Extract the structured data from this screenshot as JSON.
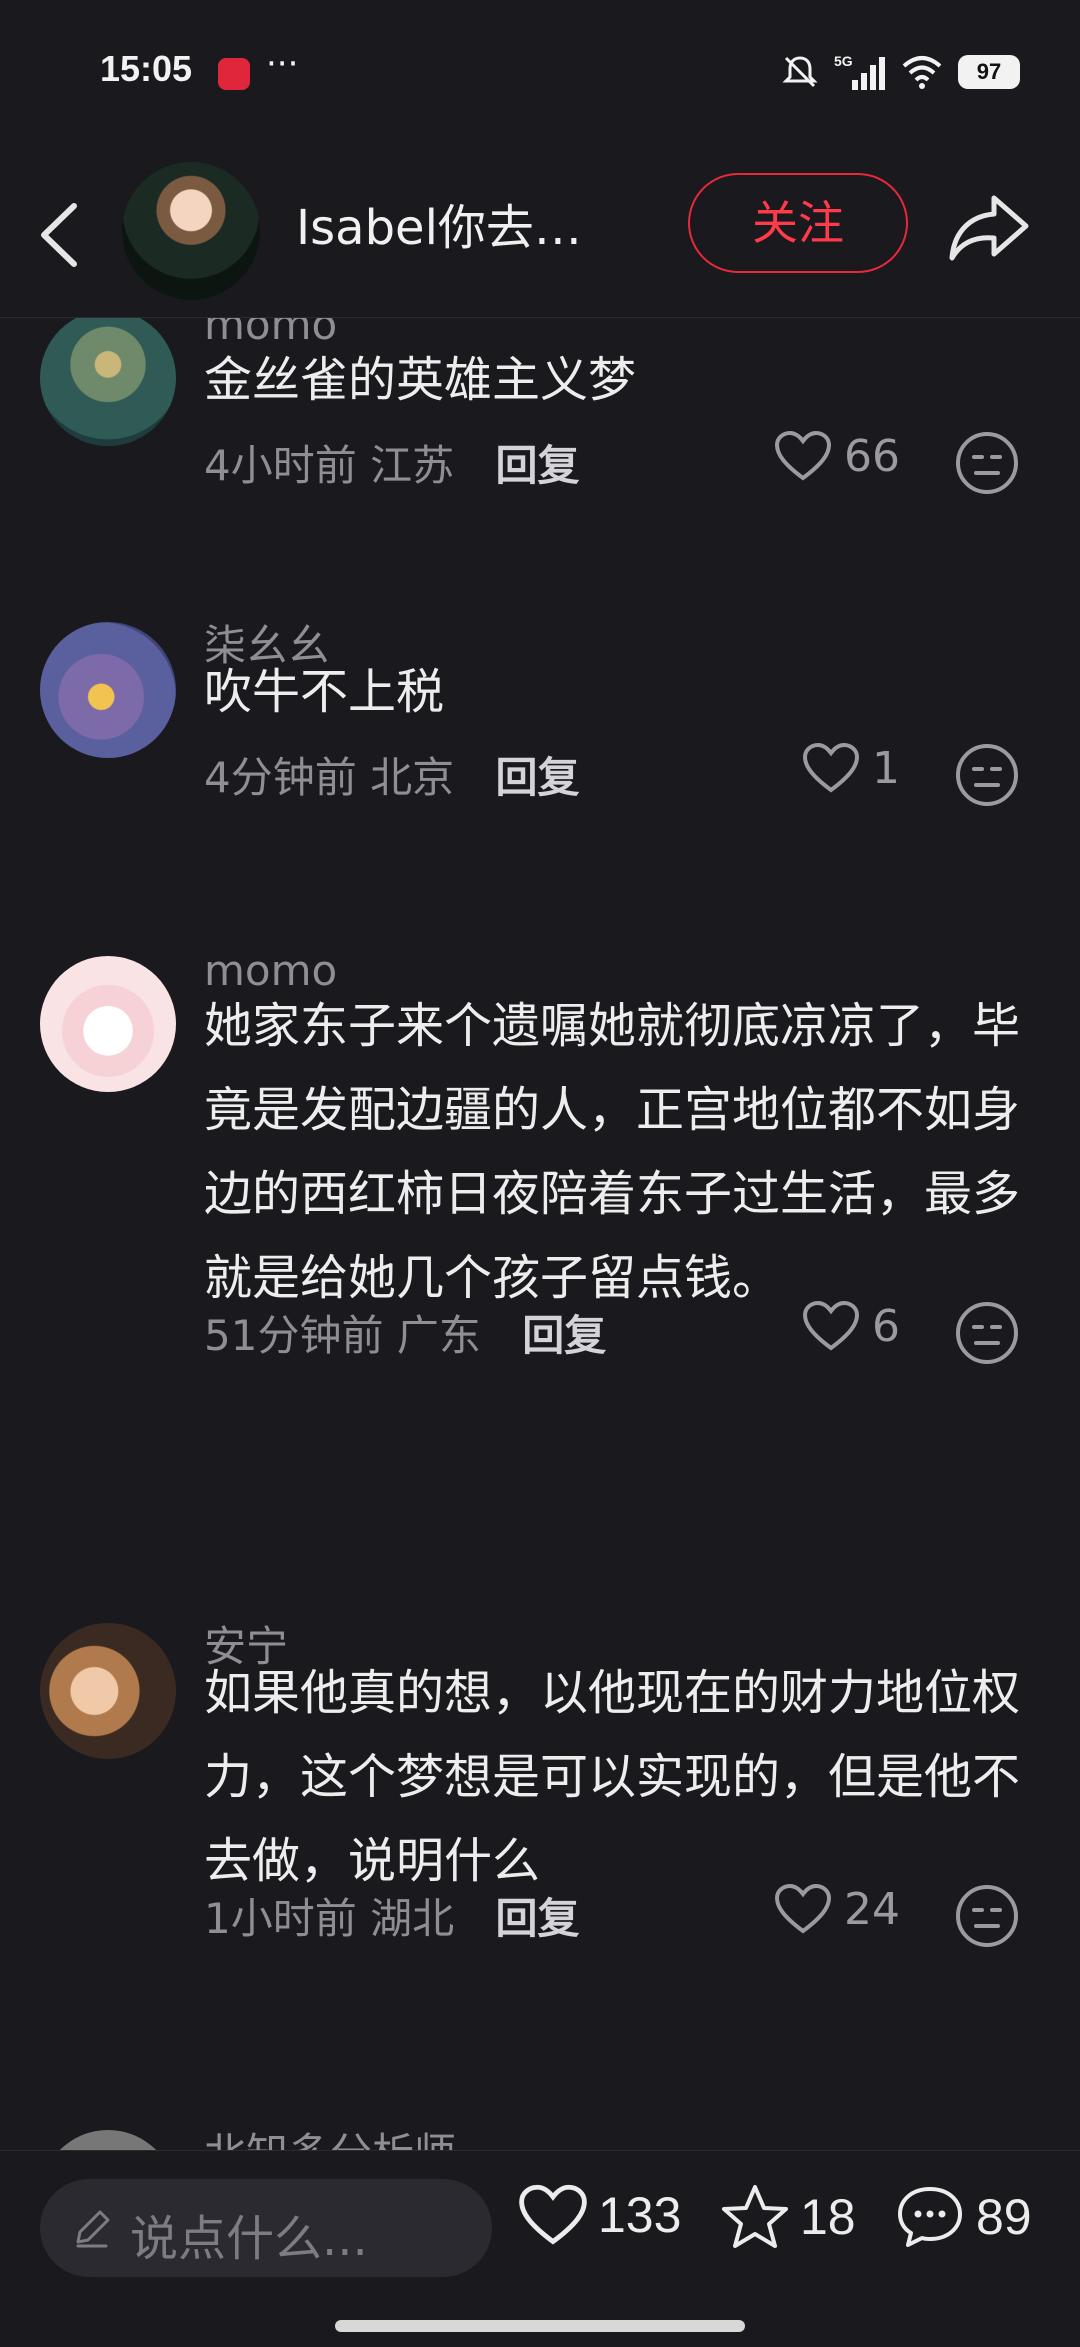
{
  "status_bar": {
    "time": "15:05",
    "app_badge": "小红书",
    "more": "···",
    "network": "5G",
    "battery": "97"
  },
  "header": {
    "username": "Isabel你去…",
    "follow_label": "关注"
  },
  "comments": [
    {
      "user": "momo",
      "text": "金丝雀的英雄主义梦",
      "time": "4小时前",
      "location": "江苏",
      "reply_label": "回复",
      "likes": "66"
    },
    {
      "user": "柒幺幺",
      "text": "吹牛不上税",
      "time": "4分钟前",
      "location": "北京",
      "reply_label": "回复",
      "likes": "1"
    },
    {
      "user": "momo",
      "text": "她家东子来个遗嘱她就彻底凉凉了，毕竟是发配边疆的人，正宫地位都不如身边的西红柿日夜陪着东子过生活，最多就是给她几个孩子留点钱。",
      "time": "51分钟前",
      "location": "广东",
      "reply_label": "回复",
      "likes": "6"
    },
    {
      "user": "安宁",
      "text": "如果他真的想，以他现在的财力地位权力，这个梦想是可以实现的，但是他不去做，说明什么",
      "time": "1小时前",
      "location": "湖北",
      "reply_label": "回复",
      "likes": "24"
    },
    {
      "user": "北知多分析师"
    }
  ],
  "bottom_bar": {
    "input_placeholder": "说点什么...",
    "likes": "133",
    "stars": "18",
    "comments": "89"
  }
}
